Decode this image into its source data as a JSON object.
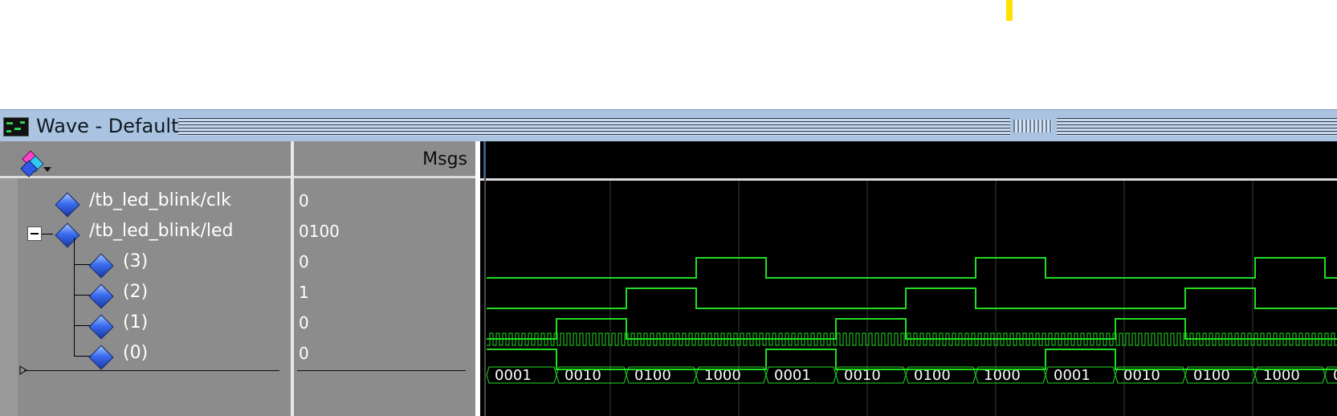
{
  "window": {
    "title": "Wave - Default"
  },
  "toolbar": {
    "icon": "wave-format-dropdown-icon"
  },
  "columns": {
    "values_header": "Msgs"
  },
  "signals": [
    {
      "name": "/tb_led_blink/clk",
      "value": "0"
    },
    {
      "name": "/tb_led_blink/led",
      "value": "0100"
    },
    {
      "name": "(3)",
      "value": "0"
    },
    {
      "name": "(2)",
      "value": "1"
    },
    {
      "name": "(1)",
      "value": "0"
    },
    {
      "name": "(0)",
      "value": "0"
    }
  ],
  "led_bus_values": [
    "0001",
    "0010",
    "0100",
    "1000",
    "0001",
    "0010",
    "0100",
    "1000",
    "0001",
    "0010",
    "0100",
    "1000",
    "0"
  ],
  "colors": {
    "wave": "#22dd22",
    "wave_bg": "#000000",
    "pane_bg": "#8c8c8c",
    "titlebar": "#a9c3e0",
    "marker": "#ffe100"
  }
}
